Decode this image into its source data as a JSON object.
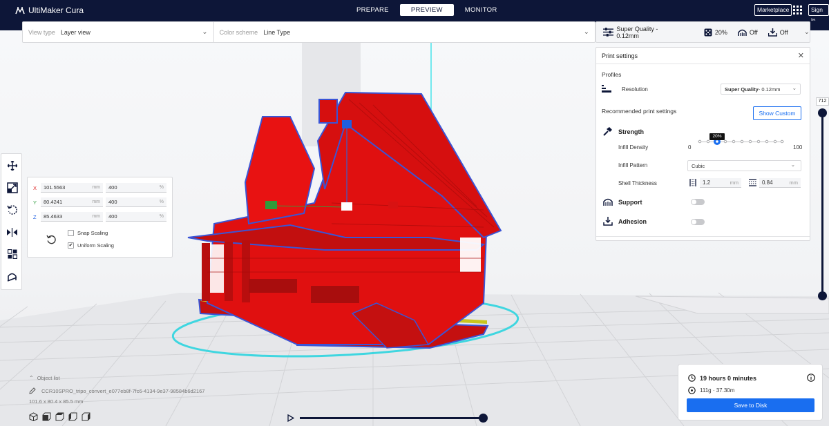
{
  "app": {
    "name": "UltiMaker Cura"
  },
  "stages": [
    {
      "label": "PREPARE",
      "active": false
    },
    {
      "label": "PREVIEW",
      "active": true
    },
    {
      "label": "MONITOR",
      "active": false
    }
  ],
  "header": {
    "marketplace_label": "Marketplace",
    "signin_label": "Sign in"
  },
  "view_bar": {
    "view_type_label": "View type",
    "view_type_value": "Layer view",
    "color_scheme_label": "Color scheme",
    "color_scheme_value": "Line Type"
  },
  "print_bar": {
    "profile": "Super Quality - 0.12mm",
    "infill": "20%",
    "support": "Off",
    "adhesion": "Off"
  },
  "print_settings": {
    "title": "Print settings",
    "profiles_label": "Profiles",
    "resolution_label": "Resolution",
    "resolution_bold": "Super Quality",
    "resolution_rest": " - 0.12mm",
    "recommended_label": "Recommended print settings",
    "show_custom_label": "Show Custom",
    "strength_label": "Strength",
    "infill_density_label": "Infill Density",
    "infill_min": "0",
    "infill_max": "100",
    "infill_value_label": "20%",
    "infill_value": 20,
    "infill_pattern_label": "Infill Pattern",
    "infill_pattern_value": "Cubic",
    "shell_thickness_label": "Shell Thickness",
    "shell_wall_value": "1.2",
    "shell_top_value": "0.84",
    "unit_mm": "mm",
    "support_label": "Support",
    "support_on": false,
    "adhesion_label": "Adhesion",
    "adhesion_on": false
  },
  "scale_panel": {
    "x_label": "X",
    "x_mm": "101.5563",
    "x_pct": "400",
    "y_label": "Y",
    "y_mm": "80.4241",
    "y_pct": "400",
    "z_label": "Z",
    "z_mm": "85.4633",
    "z_pct": "400",
    "unit_mm": "mm",
    "unit_pct": "%",
    "snap_label": "Snap Scaling",
    "snap_checked": false,
    "uniform_label": "Uniform Scaling",
    "uniform_checked": true,
    "check_mark": "✔"
  },
  "object_list": {
    "label": "Object list",
    "object_name": "CCR10SPRO_tripo_convert_e077eb8f-7fc6-4134-9e37-98584b6d2167",
    "dimensions": "101.6 x 80.4 x 85.5 mm"
  },
  "layer_slider": {
    "top_label": "712"
  },
  "estimate": {
    "time": "19 hours 0 minutes",
    "material": "111g · 37.30m",
    "save_label": "Save to Disk"
  },
  "colors": {
    "header": "#0d1638",
    "accent": "#196ef0",
    "model_red": "#e01010",
    "model_yellow": "#d4d02a",
    "shell_blue": "#3a55d6",
    "skirt_cyan": "#3fd6e0"
  }
}
